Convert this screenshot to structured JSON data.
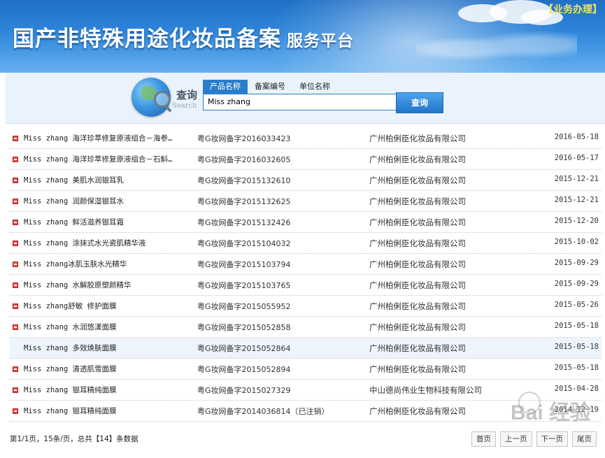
{
  "header": {
    "title": "国产非特殊用途化妆品备案",
    "subtitle": "服务平台",
    "biz_link": "【业务办理】"
  },
  "search": {
    "label": "查询",
    "label_en": "Search",
    "tabs": [
      {
        "label": "产品名称",
        "active": true
      },
      {
        "label": "备案编号",
        "active": false
      },
      {
        "label": "单位名称",
        "active": false
      }
    ],
    "input_value": "Miss zhang",
    "button": "查询"
  },
  "results": [
    {
      "name": "Miss zhang 海洋珍萃修复原液组合－海参…",
      "reg": "粤G妆网备字2016033423",
      "company": "广州柏俐臣化妆品有限公司",
      "date": "2016-05-18"
    },
    {
      "name": "Miss zhang 海洋珍萃修复原液组合－石斛…",
      "reg": "粤G妆网备字2016032605",
      "company": "广州柏俐臣化妆品有限公司",
      "date": "2016-05-17"
    },
    {
      "name": "Miss zhang 美肌水润银耳乳",
      "reg": "粤G妆网备字2015132610",
      "company": "广州柏俐臣化妆品有限公司",
      "date": "2015-12-21"
    },
    {
      "name": "Miss zhang 润颜保湿银耳水",
      "reg": "粤G妆网备字2015132625",
      "company": "广州柏俐臣化妆品有限公司",
      "date": "2015-12-21"
    },
    {
      "name": "Miss zhang 鲜活滋养银耳霜",
      "reg": "粤G妆网备字2015132426",
      "company": "广州柏俐臣化妆品有限公司",
      "date": "2015-12-20"
    },
    {
      "name": "Miss zhang 涂抹式水光瓷肌精华液",
      "reg": "粤G妆网备字2015104032",
      "company": "广州柏俐臣化妆品有限公司",
      "date": "2015-10-02"
    },
    {
      "name": "Miss zhang冰肌玉肤水光精华",
      "reg": "粤G妆网备字2015103794",
      "company": "广州柏俐臣化妆品有限公司",
      "date": "2015-09-29"
    },
    {
      "name": "Miss zhang 水解胶原塑颜精华",
      "reg": "粤G妆网备字2015103765",
      "company": "广州柏俐臣化妆品有限公司",
      "date": "2015-09-29"
    },
    {
      "name": "Miss zhang舒敏 修护面膜",
      "reg": "粤G妆网备字2015055952",
      "company": "广州柏俐臣化妆品有限公司",
      "date": "2015-05-26"
    },
    {
      "name": "Miss zhang 水润悠漾面膜",
      "reg": "粤G妆网备字2015052858",
      "company": "广州柏俐臣化妆品有限公司",
      "date": "2015-05-18"
    },
    {
      "name": "Miss zhang 多效焕肤面膜",
      "reg": "粤G妆网备字2015052864",
      "company": "广州柏俐臣化妆品有限公司",
      "date": "2015-05-18"
    },
    {
      "name": "Miss zhang 清透肌雪面膜",
      "reg": "粤G妆网备字2015052894",
      "company": "广州柏俐臣化妆品有限公司",
      "date": "2015-05-18"
    },
    {
      "name": "Miss zhang 银耳精纯面膜",
      "reg": "粤G妆网备字2015027329",
      "company": "中山德尚伟业生物科技有限公司",
      "date": "2015-04-28"
    },
    {
      "name": "Miss zhang 银耳精纯面膜",
      "reg": "粤G妆网备字2014036814（已注销）",
      "company": "广州柏俐臣化妆品有限公司",
      "date": "2014-12-19"
    }
  ],
  "pager": {
    "info": "第1/1页，15条/页，总共【14】条数据",
    "first": "首页",
    "prev": "上一页",
    "next": "下一页",
    "last": "尾页"
  },
  "watermark": "Bai 经验",
  "colors": {
    "accent": "#2a7dcb",
    "bullet": "#e24a4a"
  }
}
